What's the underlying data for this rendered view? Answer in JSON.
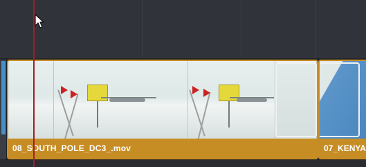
{
  "timeline": {
    "clips": [
      {
        "label": "08_SOUTH_POLE_DC3_.mov"
      },
      {
        "label": "07_KENYA"
      }
    ]
  },
  "icons": {
    "cursor": "arrow-cursor-icon"
  },
  "colors": {
    "clip_fill": "#c78d25",
    "playhead": "#a21d25",
    "background": "#30343a"
  }
}
